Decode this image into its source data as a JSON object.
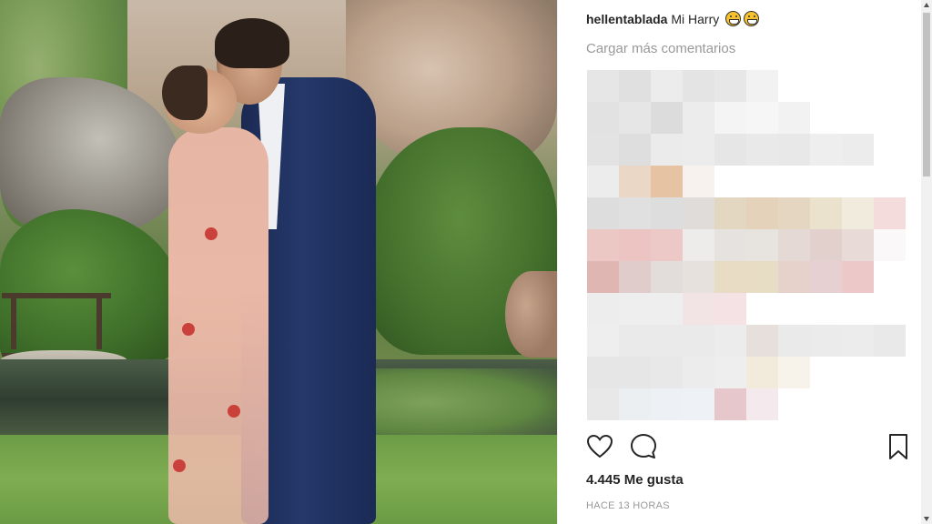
{
  "post": {
    "caption_user": "hellentablada",
    "caption_text": "Mi Harry",
    "caption_emojis": [
      "grinning-face-emoji",
      "grinning-face-emoji"
    ],
    "load_more_label": "Cargar más comentarios",
    "likes_label": "4.445 Me gusta",
    "timestamp": "HACE 13 HORAS"
  },
  "icons": {
    "like": "heart-outline-icon",
    "comment": "comment-bubble-icon",
    "save": "bookmark-icon"
  },
  "pixelated_comments_palette": [
    [
      "#e6e6e6",
      "#e0e0e0",
      "#ececec",
      "#e4e4e4",
      "#e7e7e7",
      "#f2f2f2",
      "#ffffff",
      "#ffffff",
      "#ffffff",
      "#ffffff"
    ],
    [
      "#e2e2e2",
      "#e6e6e6",
      "#dcdcdc",
      "#ececec",
      "#f4f4f4",
      "#f6f6f6",
      "#f2f2f2",
      "#ffffff",
      "#ffffff",
      "#ffffff"
    ],
    [
      "#e3e3e3",
      "#dedede",
      "#ebebeb",
      "#ececec",
      "#e6e6e6",
      "#e9e9e9",
      "#e8e8e8",
      "#eeeeee",
      "#ececec",
      "#ffffff"
    ],
    [
      "#ececec",
      "#ebd7c6",
      "#e6c3a3",
      "#f7f2ee",
      "#ffffff",
      "#ffffff",
      "#ffffff",
      "#ffffff",
      "#ffffff",
      "#ffffff"
    ],
    [
      "#dddddd",
      "#e0e0e0",
      "#dddddd",
      "#dfdcd9",
      "#e4d7c2",
      "#e4d2bb",
      "#e4d6c0",
      "#ebe2cd",
      "#f1ebdd",
      "#f5dcdc"
    ],
    [
      "#ecc8c5",
      "#ecc4c1",
      "#ecc9c6",
      "#eeeceb",
      "#e5e2df",
      "#e7e3de",
      "#e5d9d5",
      "#e2d0cc",
      "#e8dbd7",
      "#faf8f8"
    ],
    [
      "#dfb6b2",
      "#e0cdcb",
      "#e2dcdb",
      "#e6e1dc",
      "#e8dcc5",
      "#e7dcc4",
      "#e7d1cb",
      "#e7d0d2",
      "#ecc8c8",
      "#ffffff"
    ],
    [
      "#ededed",
      "#eeeeee",
      "#eeeeee",
      "#f2e3e5",
      "#f5e2e4",
      "#ffffff",
      "#ffffff",
      "#ffffff",
      "#ffffff",
      "#ffffff"
    ],
    [
      "#eeeeee",
      "#eaeaea",
      "#eaeaea",
      "#eaeaea",
      "#ececec",
      "#e7dfdc",
      "#eaeaea",
      "#ebebeb",
      "#ececec",
      "#e9e9e9"
    ],
    [
      "#e6e6e6",
      "#e6e6e6",
      "#e8e8e8",
      "#ececec",
      "#eeeeee",
      "#f2eadb",
      "#f8f3ea",
      "#ffffff",
      "#ffffff",
      "#ffffff"
    ],
    [
      "#e8e8e8",
      "#eceff2",
      "#edf0f4",
      "#eef1f6",
      "#e6c8cc",
      "#f4e9ec",
      "#ffffff",
      "#ffffff",
      "#ffffff",
      "#ffffff"
    ]
  ]
}
